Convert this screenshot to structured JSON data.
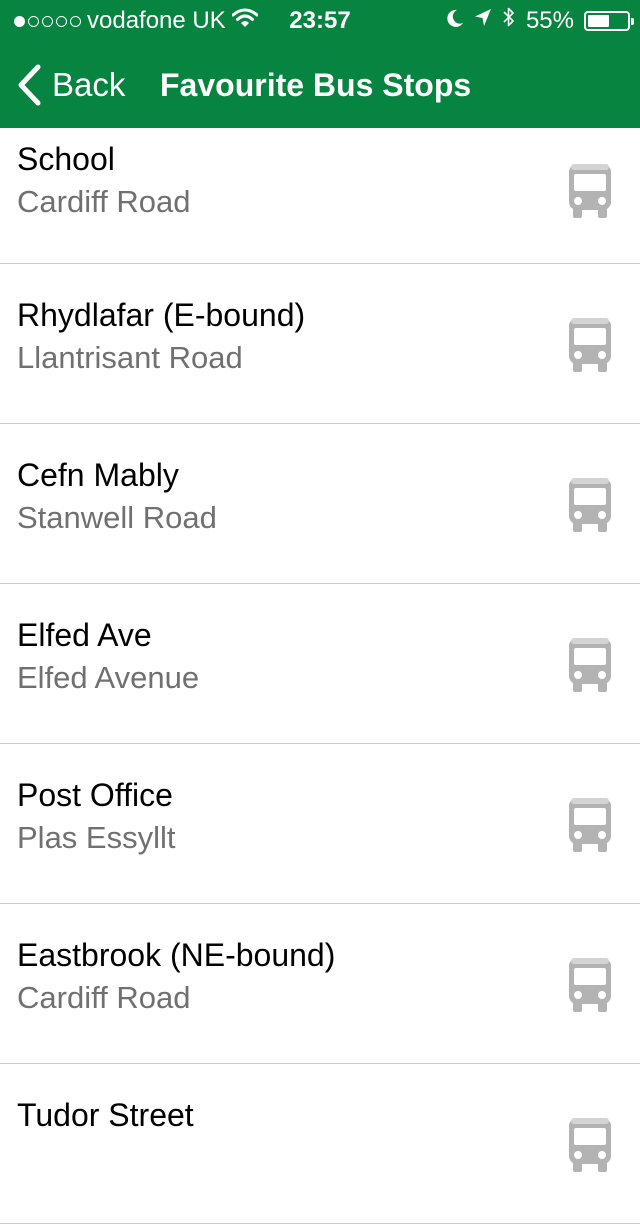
{
  "status_bar": {
    "carrier": "vodafone UK",
    "time": "23:57",
    "battery_percent": "55%",
    "battery_level": 0.55,
    "signal_bars_filled": 1,
    "signal_bars_total": 5,
    "icons": [
      "wifi-icon",
      "moon-icon",
      "location-arrow-icon",
      "bluetooth-icon",
      "battery-icon"
    ]
  },
  "nav": {
    "back_label": "Back",
    "title": "Favourite Bus Stops"
  },
  "colors": {
    "brand": "#07843f",
    "icon_gray": "#b3b3b3",
    "subtitle_gray": "#707070",
    "separator": "#c8c7cc"
  },
  "stops": [
    {
      "name": "School",
      "road": "Cardiff Road",
      "icon": "bus-icon"
    },
    {
      "name": "Rhydlafar (E-bound)",
      "road": "Llantrisant Road",
      "icon": "bus-icon"
    },
    {
      "name": "Cefn Mably",
      "road": "Stanwell Road",
      "icon": "bus-icon"
    },
    {
      "name": "Elfed Ave",
      "road": "Elfed Avenue",
      "icon": "bus-icon"
    },
    {
      "name": "Post Office",
      "road": "Plas Essyllt",
      "icon": "bus-icon"
    },
    {
      "name": "Eastbrook (NE-bound)",
      "road": "Cardiff Road",
      "icon": "bus-icon"
    },
    {
      "name": "Tudor Street",
      "road": "",
      "icon": "bus-icon"
    }
  ]
}
